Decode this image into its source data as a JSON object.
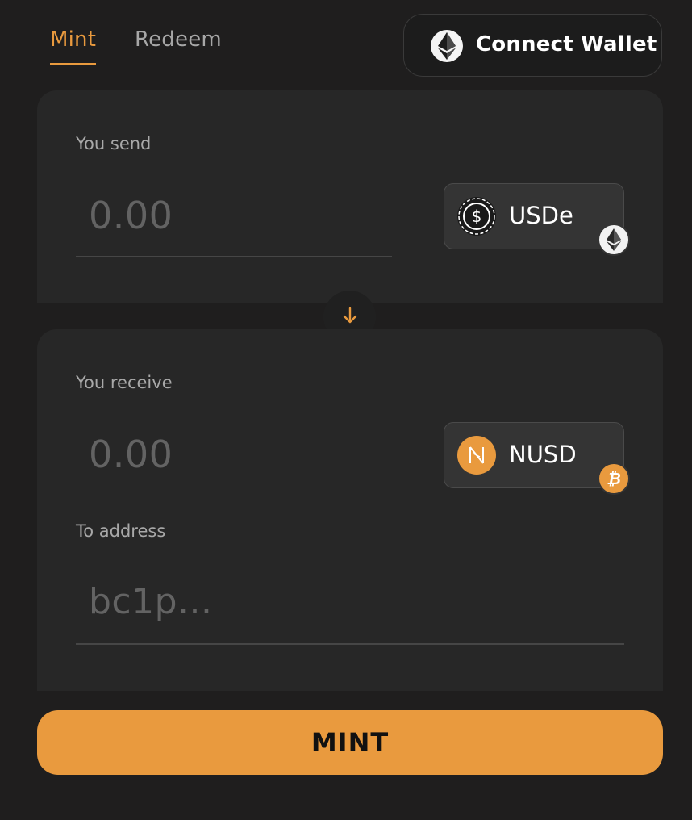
{
  "tabs": {
    "mint": "Mint",
    "redeem": "Redeem"
  },
  "wallet": {
    "connect_label": "Connect Wallet",
    "icon": "ethereum-icon"
  },
  "send": {
    "label": "You send",
    "amount_placeholder": "0.00",
    "token": "USDe",
    "token_icon": "usde-icon",
    "chain_icon": "ethereum-icon"
  },
  "swap": {
    "icon": "arrow-down-icon"
  },
  "receive": {
    "label": "You receive",
    "amount_placeholder": "0.00",
    "token": "NUSD",
    "token_icon": "nusd-icon",
    "chain_icon": "bitcoin-icon",
    "address_label": "To address",
    "address_placeholder": "bc1p..."
  },
  "action": {
    "mint_label": "MINT"
  },
  "colors": {
    "accent": "#e99a3e",
    "background": "#1f1e1e",
    "panel": "#272727"
  }
}
